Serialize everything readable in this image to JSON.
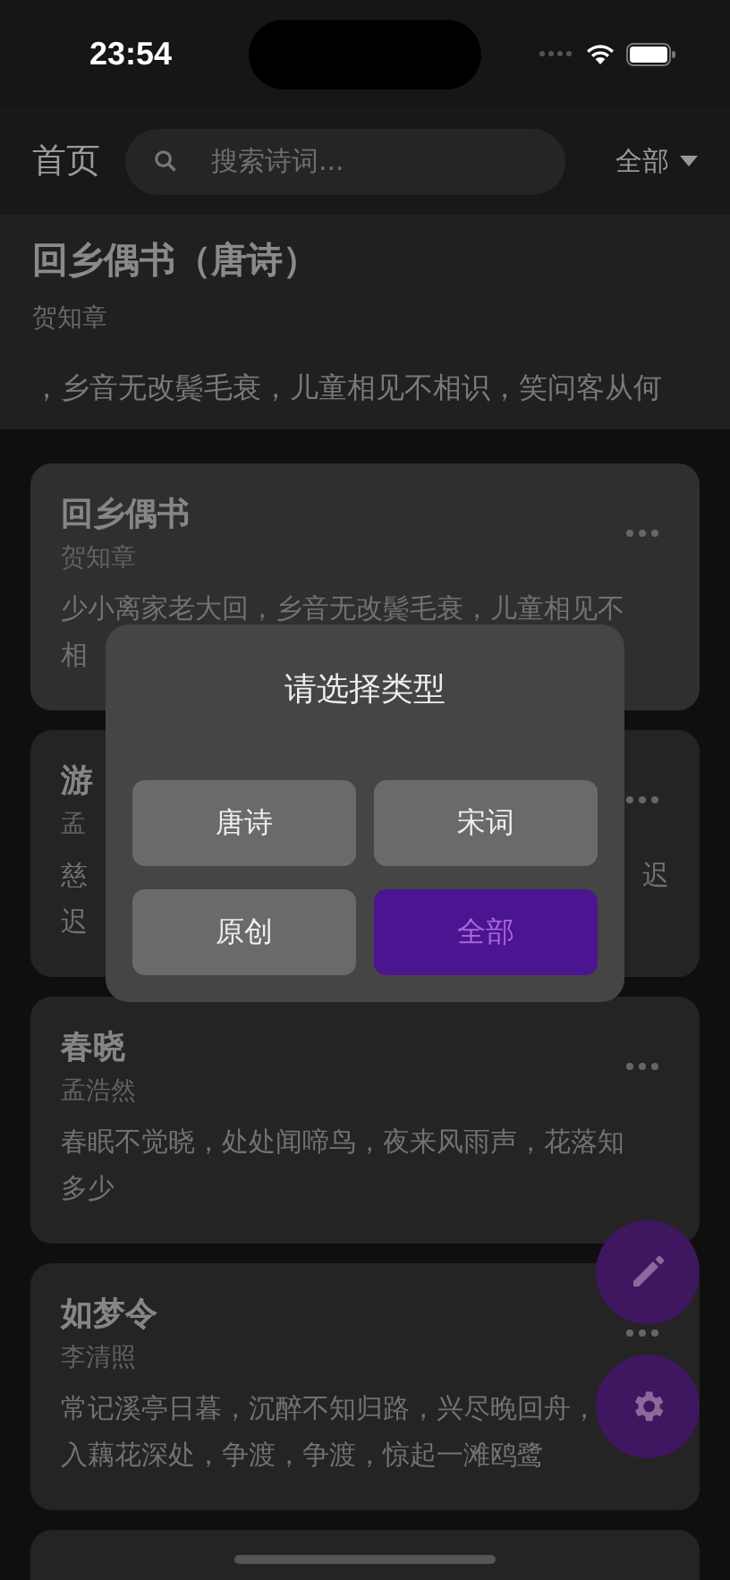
{
  "status_bar": {
    "time": "23:54"
  },
  "header": {
    "title": "首页",
    "search": {
      "placeholder": "搜索诗词..."
    },
    "filter": {
      "label": "全部"
    }
  },
  "featured": {
    "title": "回乡偶书（唐诗）",
    "author": "贺知章",
    "ticker": "，乡音无改鬓毛衰，儿童相见不相识，笑问客从何"
  },
  "cards": [
    {
      "title": "回乡偶书",
      "author": "贺知章",
      "lines": [
        {
          "start": "少小离家老大回，乡音无改鬓毛衰，儿童相见不"
        },
        {
          "start": "相"
        }
      ]
    },
    {
      "title": "游",
      "author": "孟",
      "lines": [
        {
          "start": "慈",
          "end": "迟"
        },
        {
          "start": "迟"
        }
      ]
    },
    {
      "title": "春晓",
      "author": "孟浩然",
      "lines": [
        {
          "start": "春眠不觉晓，处处闻啼鸟，夜来风雨声，花落知"
        },
        {
          "start": "多少"
        }
      ]
    },
    {
      "title": "如梦令",
      "author": "李清照",
      "lines": [
        {
          "start": "常记溪亭日暮，沉醉不知归路，兴尽晚回舟，"
        },
        {
          "start": "入藕花深处，争渡，争渡，惊起一滩鸥鹭"
        }
      ]
    }
  ],
  "dialog": {
    "title": "请选择类型",
    "options": [
      {
        "label": "唐诗",
        "selected": false
      },
      {
        "label": "宋词",
        "selected": false
      },
      {
        "label": "原创",
        "selected": false
      },
      {
        "label": "全部",
        "selected": true
      }
    ]
  }
}
